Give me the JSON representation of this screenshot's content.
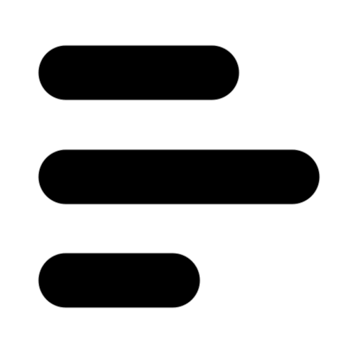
{
  "icon": {
    "name": "menu-lines-icon",
    "style": "rounded bars",
    "color": "#000000",
    "background": "#ffffff",
    "bars": [
      {
        "name": "top-bar",
        "length_fraction": 0.72
      },
      {
        "name": "middle-bar",
        "length_fraction": 1.0
      },
      {
        "name": "bottom-bar",
        "length_fraction": 0.58
      }
    ]
  }
}
